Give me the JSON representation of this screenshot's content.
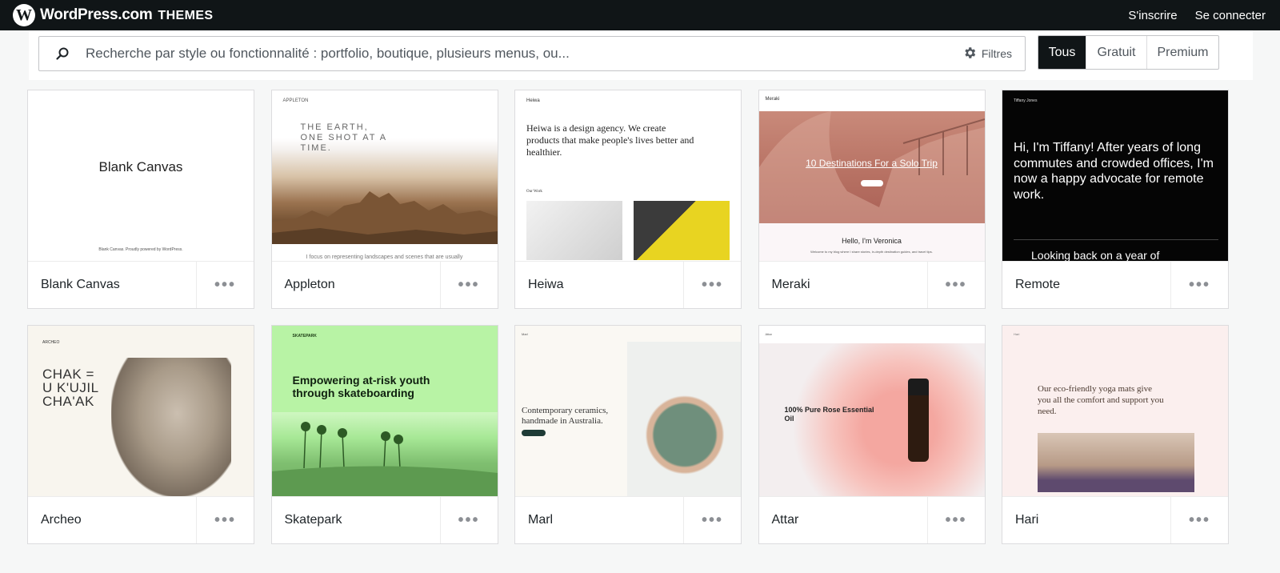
{
  "header": {
    "logo_glyph": "W",
    "brand": "WordPress.com",
    "section": "THEMES",
    "signup": "S'inscrire",
    "login": "Se connecter"
  },
  "search": {
    "placeholder": "Recherche par style ou fonctionnalité : portfolio, boutique, plusieurs menus, ou...",
    "filters_label": "Filtres"
  },
  "tiers": {
    "options": [
      "Tous",
      "Gratuit",
      "Premium"
    ],
    "selected": "Tous"
  },
  "more_label": "•••",
  "themes": [
    {
      "name": "Blank Canvas",
      "preview": {
        "title": "Blank Canvas",
        "footer": "Blank Canvas. Proudly powered by WordPress."
      }
    },
    {
      "name": "Appleton",
      "preview": {
        "nav": "APPLETON",
        "hero": "THE EARTH, ONE SHOT AT A TIME.",
        "caption": "I focus on representing landscapes and scenes that are usually"
      }
    },
    {
      "name": "Heiwa",
      "preview": {
        "nav": "Heiwa",
        "hero": "Heiwa is a design agency. We create products that make people's lives better and healthier.",
        "section": "Our Work"
      }
    },
    {
      "name": "Meraki",
      "preview": {
        "nav": "Meraki",
        "headline": "10 Destinations For a Solo Trip",
        "hello": "Hello, I'm Veronica",
        "tagline": "Welcome to my blog where I share stories, in-depth destination guides, and travel tips."
      }
    },
    {
      "name": "Remote",
      "preview": {
        "nav": "Tiffany Jones",
        "hero": "Hi, I'm Tiffany! After years of long commutes and crowded offices, I'm now a happy advocate for remote work.",
        "next": "Looking back on a year of"
      }
    },
    {
      "name": "Archeo",
      "preview": {
        "nav": "ARCHEO",
        "hero": "CHAK = U K'UJIL CHA'AK"
      }
    },
    {
      "name": "Skatepark",
      "preview": {
        "nav": "SKATEPARK",
        "hero": "Empowering at-risk youth through skateboarding"
      }
    },
    {
      "name": "Marl",
      "preview": {
        "nav": "Marl",
        "hero": "Contemporary ceramics, handmade in Australia."
      }
    },
    {
      "name": "Attar",
      "preview": {
        "nav": "Attar",
        "hero": "100% Pure Rose Essential Oil"
      }
    },
    {
      "name": "Hari",
      "preview": {
        "nav": "Hari",
        "hero": "Our eco-friendly yoga mats give you all the comfort and support you need."
      }
    }
  ]
}
